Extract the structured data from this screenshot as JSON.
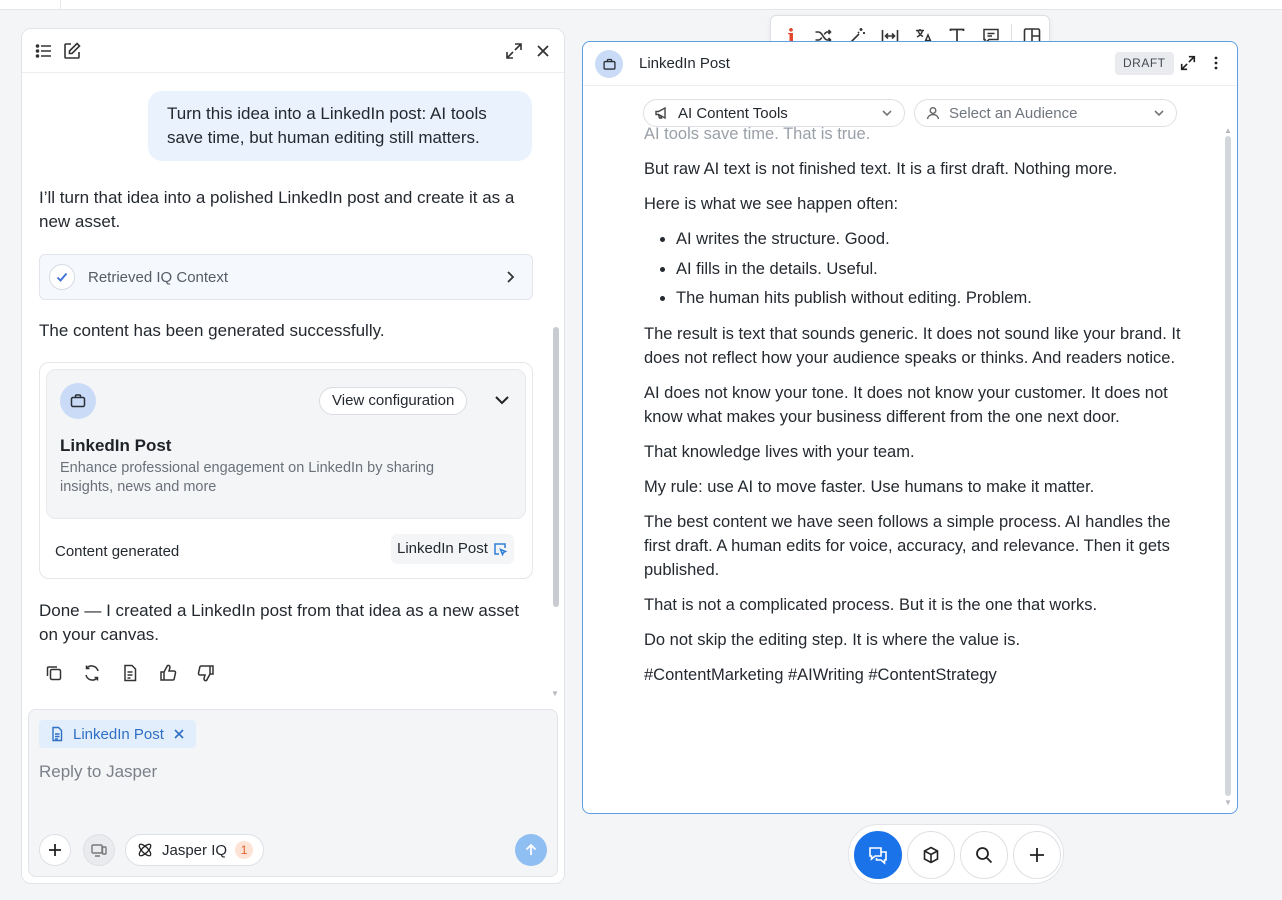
{
  "chat": {
    "user_message": "Turn this idea into a LinkedIn post: AI tools save time, but human editing still matters.",
    "assistant_intro": "I’ll turn that idea into a polished LinkedIn post and create it as a new asset.",
    "context_label": "Retrieved IQ Context",
    "generated_text": "The content has been generated successfully.",
    "asset_card": {
      "view_config_label": "View configuration",
      "title": "LinkedIn Post",
      "description": "Enhance professional engagement on LinkedIn by sharing insights, news and more",
      "status": "Content generated",
      "link_label": "LinkedIn Post"
    },
    "done_text": "Done — I created a LinkedIn post from that idea as a new asset on your canvas.",
    "composer": {
      "attachment_label": "LinkedIn Post",
      "placeholder": "Reply to Jasper",
      "iq_label": "Jasper IQ",
      "iq_count": "1"
    }
  },
  "toolbar": {
    "j_label": "j"
  },
  "document": {
    "title": "LinkedIn Post",
    "status_badge": "DRAFT",
    "tools_select": "AI Content Tools",
    "audience_placeholder": "Select an Audience",
    "faded_line": "AI tools save time. That is true.",
    "paragraphs_a": [
      "But raw AI text is not finished text. It is a first draft. Nothing more.",
      "Here is what we see happen often:"
    ],
    "bullets": [
      "AI writes the structure. Good.",
      "AI fills in the details. Useful.",
      "The human hits publish without editing. Problem."
    ],
    "paragraphs_b": [
      "The result is text that sounds generic. It does not sound like your brand. It does not reflect how your audience speaks or thinks. And readers notice.",
      "AI does not know your tone. It does not know your customer. It does not know what makes your business different from the one next door.",
      "That knowledge lives with your team.",
      "My rule: use AI to move faster. Use humans to make it matter.",
      "The best content we have seen follows a simple process. AI handles the first draft. A human edits for voice, accuracy, and relevance. Then it gets published.",
      "That is not a complicated process. But it is the one that works.",
      "Do not skip the editing step. It is where the value is.",
      "#ContentMarketing #AIWriting #ContentStrategy"
    ]
  },
  "colors": {
    "accent": "#1a73e8",
    "bubble": "#eaf2fd",
    "brand_j": "#e2462b",
    "panel_border": "#5d9fe0"
  }
}
